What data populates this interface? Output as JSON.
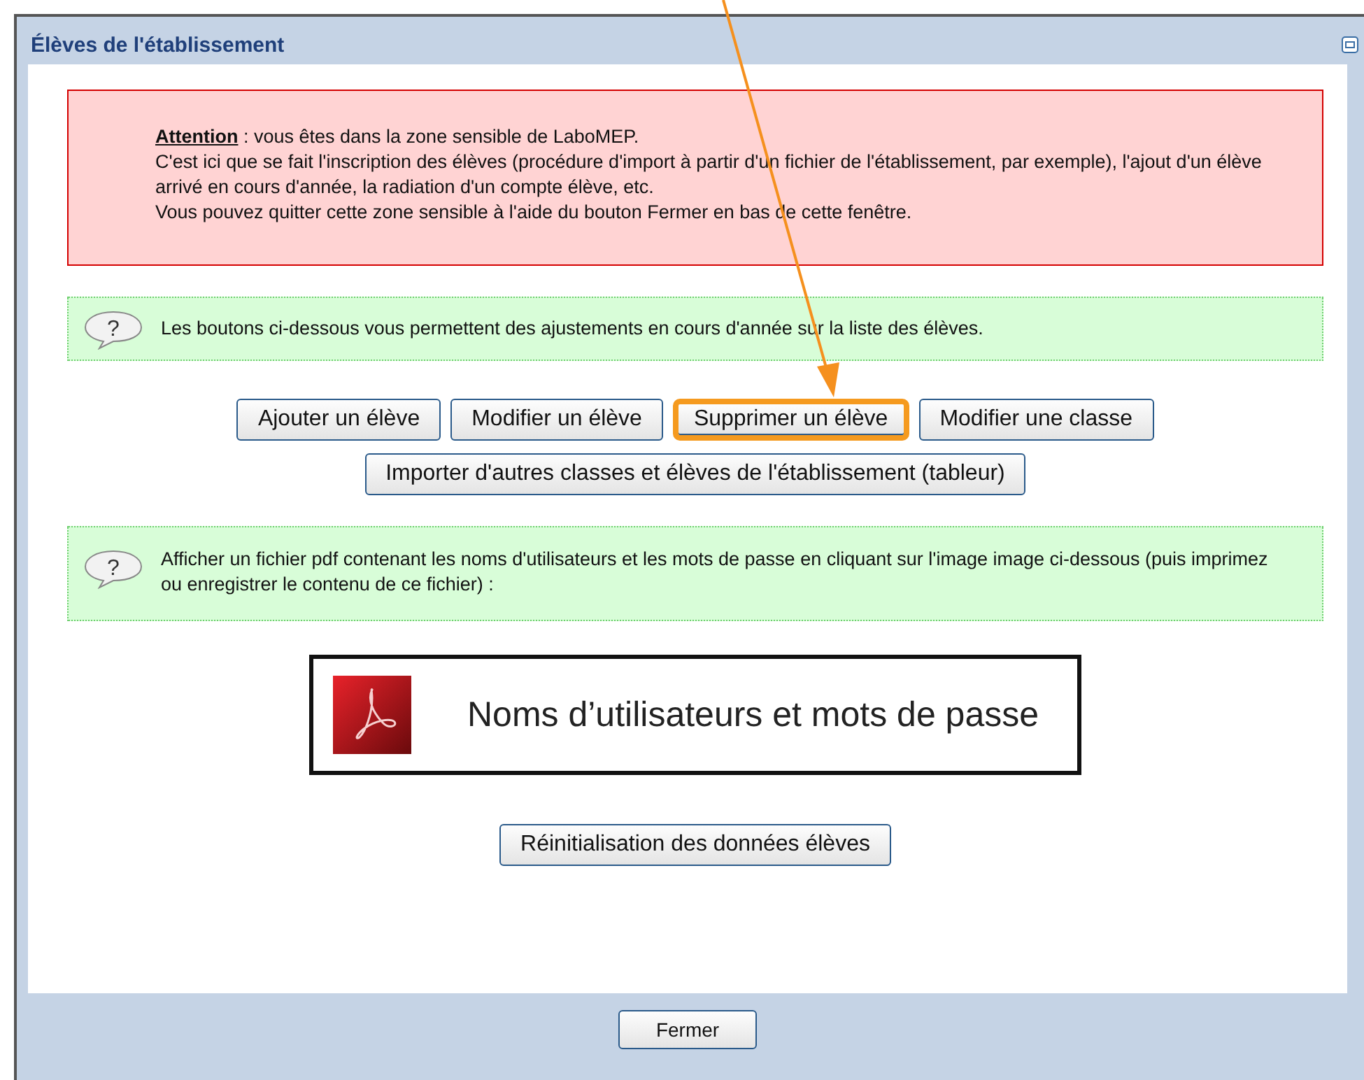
{
  "window": {
    "title": "Élèves de l'établissement"
  },
  "warning": {
    "lines": [
      "**Attention** : vous êtes dans la zone sensible de LaboMEP.",
      "C'est ici que se fait l'inscription des élèves (procédure d'import à partir d'un fichier de l'établissement, par exemple), l'ajout d'un élève arrivé en cours d'année, la radiation d'un compte élève, etc.",
      "Vous pouvez quitter cette zone sensible à l'aide du bouton Fermer en bas de cette fenêtre."
    ]
  },
  "info_1": {
    "icon_glyph": "?",
    "text": "Les boutons ci-dessous vous permettent des ajustements en cours d'année sur la liste des élèves."
  },
  "buttons": [
    {
      "label": "Ajouter un élève",
      "highlighted": false
    },
    {
      "label": "Modifier un élève",
      "highlighted": false
    },
    {
      "label": "Supprimer un élève",
      "highlighted": true
    },
    {
      "label": "Modifier une classe",
      "highlighted": false
    }
  ],
  "import_button": "Importer d'autres classes et élèves de l'établissement (tableur)",
  "info_2": {
    "icon_glyph": "?",
    "text": "Afficher un fichier pdf contenant les noms d'utilisateurs et les mots de passe en cliquant sur l'image image ci-dessous (puis imprimez ou enregistrer le contenu de ce fichier) :"
  },
  "pdf_link": "Noms d’utilisateurs et mots de passe",
  "reset_button": "Réinitialisation des données élèves",
  "footer": {
    "close_button": "Fermer"
  }
}
